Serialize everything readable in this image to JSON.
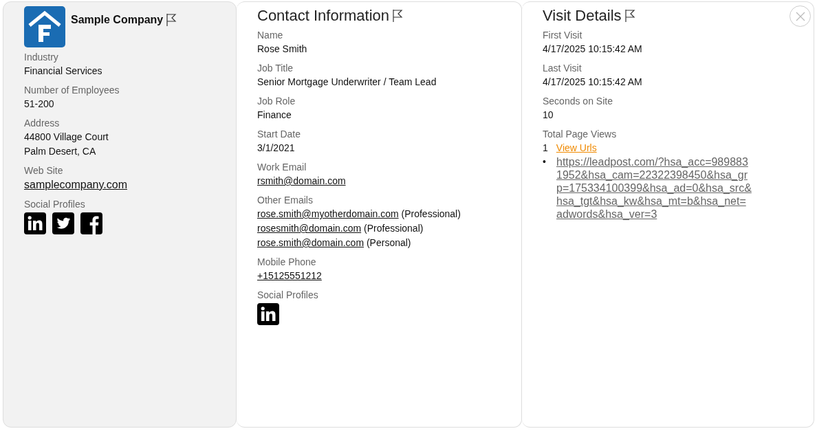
{
  "company": {
    "name": "Sample Company",
    "flagged": false,
    "fields": [
      {
        "label": "Industry",
        "lines": [
          {
            "kind": "text",
            "text": "Financial Services"
          }
        ]
      },
      {
        "label": "Number of Employees",
        "lines": [
          {
            "kind": "text",
            "text": "51-200"
          }
        ]
      },
      {
        "label": "Address",
        "lines": [
          {
            "kind": "text",
            "text": "44800 Village Court"
          },
          {
            "kind": "text",
            "text": "Palm Desert, CA"
          }
        ]
      },
      {
        "label": "Web Site",
        "lines": [
          {
            "kind": "biglink",
            "text": "samplecompany.com"
          }
        ]
      }
    ],
    "social_label": "Social Profiles",
    "social_profiles": [
      {
        "kind": "linkedin"
      },
      {
        "kind": "twitter"
      },
      {
        "kind": "facebook"
      }
    ]
  },
  "contact": {
    "title": "Contact Information",
    "flagged": false,
    "fields": [
      {
        "label": "Name",
        "lines": [
          {
            "kind": "text",
            "text": "Rose Smith"
          }
        ]
      },
      {
        "label": "Job Title",
        "lines": [
          {
            "kind": "text",
            "text": "Senior Mortgage Underwriter / Team Lead"
          }
        ]
      },
      {
        "label": "Job Role",
        "lines": [
          {
            "kind": "text",
            "text": "Finance"
          }
        ]
      },
      {
        "label": "Start Date",
        "lines": [
          {
            "kind": "text",
            "text": "3/1/2021"
          }
        ]
      },
      {
        "label": "Work Email",
        "lines": [
          {
            "kind": "link",
            "text": "rsmith@domain.com"
          }
        ]
      },
      {
        "label": "Other Emails",
        "lines": [
          {
            "kind": "link",
            "text": "rose.smith@myotherdomain.com",
            "note": "(Professional)"
          },
          {
            "kind": "link",
            "text": "rosesmith@domain.com",
            "note": "(Professional)"
          },
          {
            "kind": "link",
            "text": "rose.smith@domain.com",
            "note": "(Personal)"
          }
        ]
      },
      {
        "label": "Mobile Phone",
        "lines": [
          {
            "kind": "link",
            "text": "+15125551212"
          }
        ]
      }
    ],
    "social_label": "Social Profiles",
    "social_profiles": [
      {
        "kind": "linkedin"
      }
    ]
  },
  "visit": {
    "title": "Visit Details",
    "flagged": false,
    "fields": [
      {
        "label": "First Visit",
        "lines": [
          {
            "kind": "text",
            "text": "4/17/2025 10:15:42 AM"
          }
        ]
      },
      {
        "label": "Last Visit",
        "lines": [
          {
            "kind": "text",
            "text": "4/17/2025 10:15:42 AM"
          }
        ]
      },
      {
        "label": "Seconds on Site",
        "lines": [
          {
            "kind": "text",
            "text": "10"
          }
        ]
      }
    ],
    "page_views": {
      "label": "Total Page Views",
      "count": "1",
      "toggle": "View Urls",
      "bullet": "•",
      "urls": [
        "https://leadpost.com/?hsa_acc=9898831952&hsa_cam=22322398450&hsa_grp=175334100399&hsa_ad=0&hsa_src&hsa_tgt&hsa_kw&hsa_mt=b&hsa_net=adwords&hsa_ver=3"
      ]
    }
  }
}
